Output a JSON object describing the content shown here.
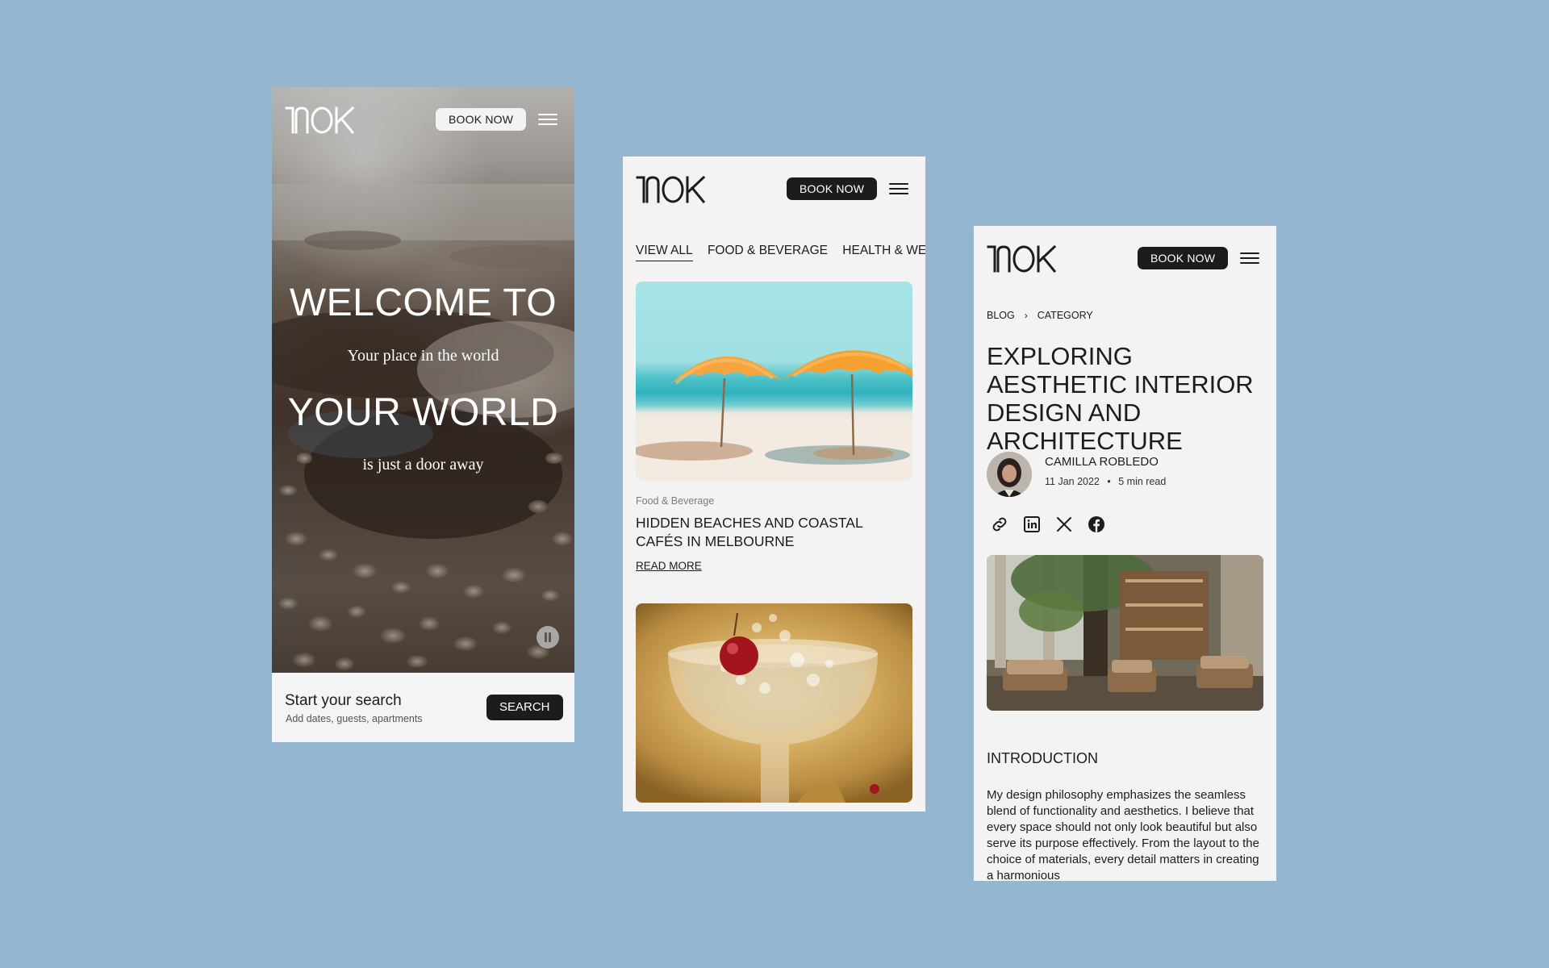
{
  "brand": {
    "logo": "NOK"
  },
  "colors": {
    "background": "#95b6cf",
    "dark": "#1c1c1c",
    "light": "#f3f3f3"
  },
  "screen_home": {
    "book_now": "BOOK NOW",
    "menu_icon": "hamburger-icon",
    "hero": {
      "line1": "WELCOME TO",
      "line2": "Your place in the world",
      "line3": "YOUR WORLD",
      "line4": "is just a door away"
    },
    "pause_icon": "pause-icon",
    "search": {
      "title": "Start your search",
      "subtitle": "Add dates, guests, apartments",
      "button": "SEARCH"
    }
  },
  "screen_blog": {
    "book_now": "BOOK NOW",
    "menu_icon": "hamburger-icon",
    "tabs": [
      {
        "label": "VIEW ALL",
        "active": true
      },
      {
        "label": "FOOD & BEVERAGE",
        "active": false
      },
      {
        "label": "HEALTH & WELL",
        "active": false
      }
    ],
    "cards": [
      {
        "category": "Food & Beverage",
        "title": "HIDDEN BEACHES AND COASTAL CAFÉS IN MELBOURNE",
        "link": "READ MORE"
      }
    ]
  },
  "screen_article": {
    "book_now": "BOOK NOW",
    "menu_icon": "hamburger-icon",
    "breadcrumb": {
      "root": "BLOG",
      "current": "CATEGORY",
      "separator_icon": "chevron-right-icon"
    },
    "title": "EXPLORING AESTHETIC INTERIOR DESIGN AND ARCHITECTURE",
    "author": {
      "name": "CAMILLA ROBLEDO",
      "date": "11 Jan 2022",
      "dot": "•",
      "read_time": "5 min read"
    },
    "share_icons": [
      "link-icon",
      "linkedin-icon",
      "x-icon",
      "facebook-icon"
    ],
    "section_heading": "INTRODUCTION",
    "body": "My design philosophy emphasizes the seamless blend of functionality and aesthetics. I believe that every space should not only look beautiful but also serve its purpose effectively. From the layout to the choice of materials, every detail matters in creating a harmonious"
  }
}
